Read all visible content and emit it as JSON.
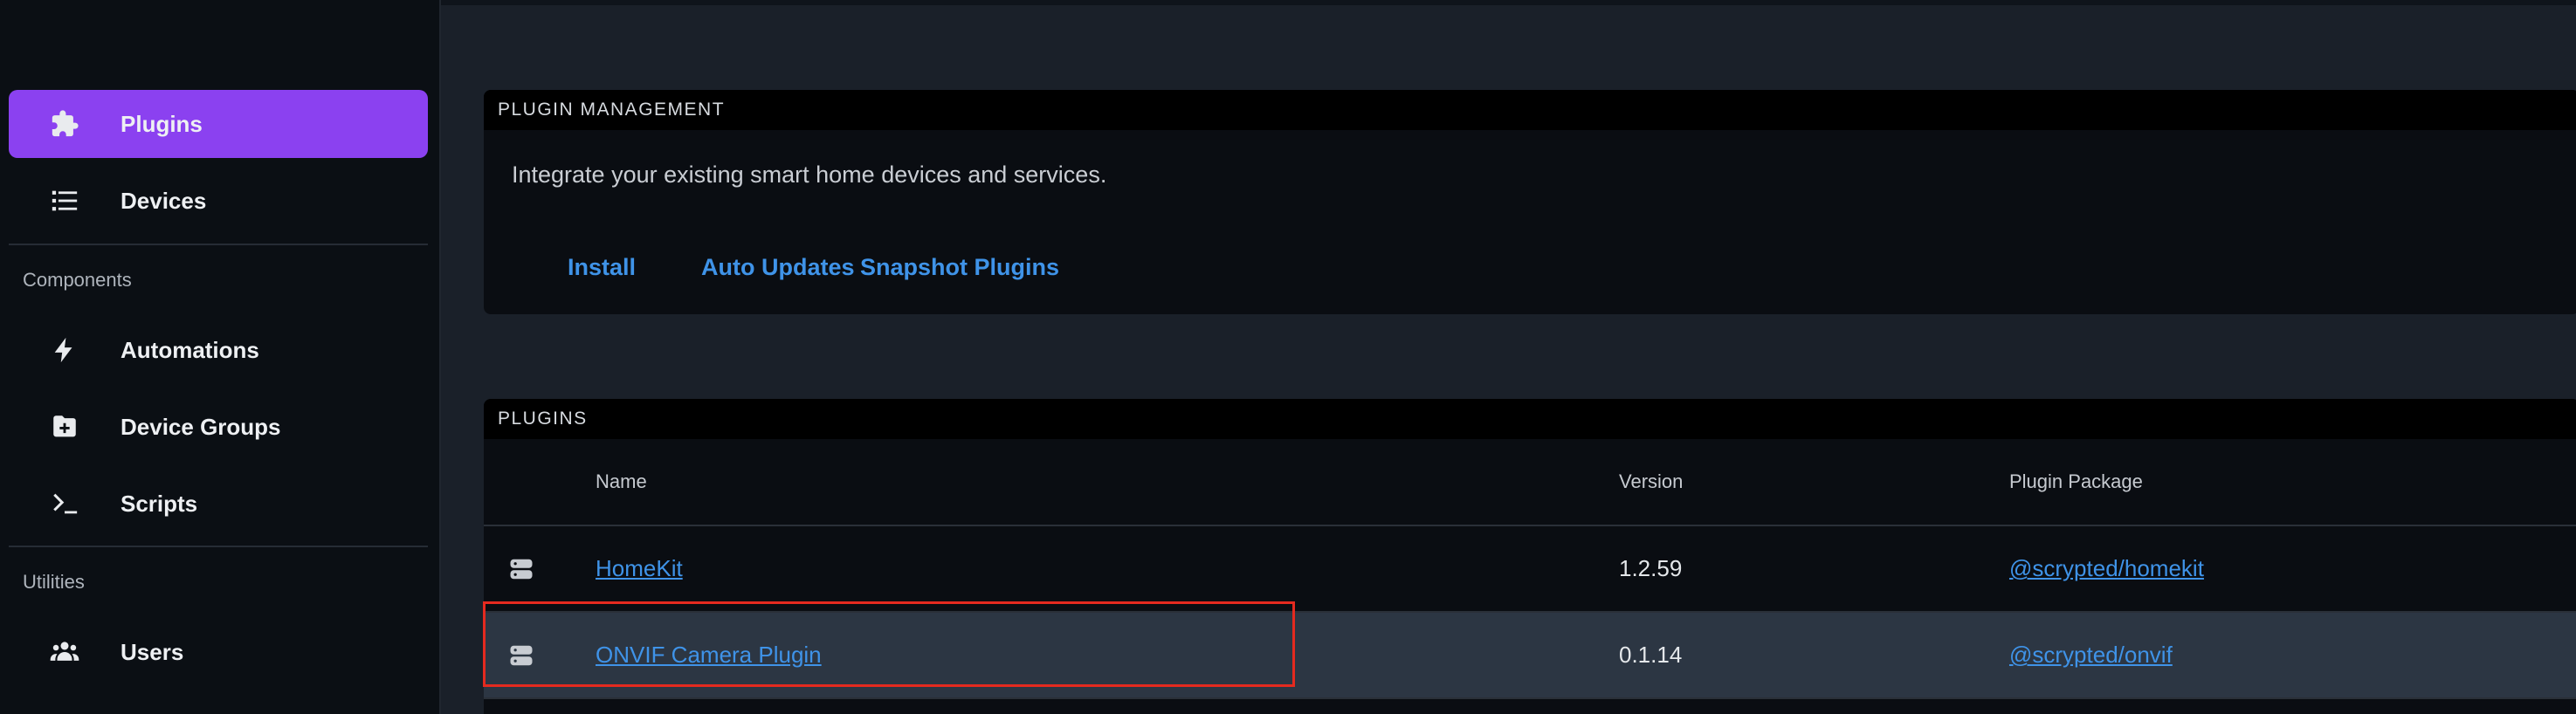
{
  "sidebar": {
    "items_top": [
      {
        "label": "Plugins",
        "icon": "puzzle-icon",
        "active": true
      },
      {
        "label": "Devices",
        "icon": "list-icon",
        "active": false
      }
    ],
    "components_label": "Components",
    "components": [
      {
        "label": "Automations",
        "icon": "bolt-icon"
      },
      {
        "label": "Device Groups",
        "icon": "folder-plus-icon"
      },
      {
        "label": "Scripts",
        "icon": "terminal-icon"
      }
    ],
    "utilities_label": "Utilities",
    "utilities": [
      {
        "label": "Users",
        "icon": "users-icon"
      }
    ]
  },
  "plugin_management": {
    "header": "PLUGIN MANAGEMENT",
    "description": "Integrate your existing smart home devices and services.",
    "buttons": [
      "Install",
      "Auto Updates",
      "Snapshot Plugins"
    ]
  },
  "plugins": {
    "header": "PLUGINS",
    "columns": [
      "Name",
      "Version",
      "Plugin Package"
    ],
    "rows": [
      {
        "name": "HomeKit",
        "version": "1.2.59",
        "package": "@scrypted/homekit"
      },
      {
        "name": "ONVIF Camera Plugin",
        "version": "0.1.14",
        "package": "@scrypted/onvif"
      }
    ]
  },
  "colors": {
    "accent": "#8b41f0",
    "link": "#3f93e8",
    "highlight": "#e52a1f"
  }
}
